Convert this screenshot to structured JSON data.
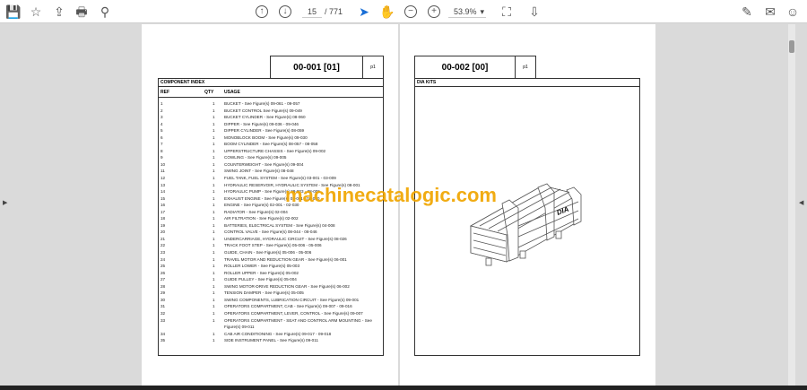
{
  "toolbar": {
    "page_current": "15",
    "page_total": "/ 771",
    "zoom": "53.9%",
    "zoom_caret": "▾"
  },
  "icons": {
    "save": "💾",
    "bookmark": "☆",
    "upload": "⇪",
    "print": "🖶",
    "search": "⚲",
    "prev": "↑",
    "next": "↓",
    "cursor": "➤",
    "hand": "✋",
    "zoom_out": "−",
    "zoom_in": "+",
    "fit": "⛶",
    "scroll": "⇩",
    "sign": "✎",
    "mail": "✉",
    "account": "☺"
  },
  "left_page": {
    "code": "00-001 [01]",
    "p": "p1",
    "title": "COMPONENT INDEX",
    "headers": {
      "ref": "REF",
      "qty": "QTY",
      "usage": "USAGE"
    },
    "rows": [
      [
        "1",
        "1",
        "BUCKET - See Figure(s) 09-061 - 09-057"
      ],
      [
        "2",
        "1",
        "BUCKET CONTROL See Figure(s) 09-049"
      ],
      [
        "3",
        "1",
        "BUCKET CYLINDER - See Figure(s) 08-060"
      ],
      [
        "4",
        "1",
        "DIPPER - See Figure(s) 09-036 - 09-046"
      ],
      [
        "5",
        "1",
        "DIPPER CYLINDER - See Figure(s) 08-059"
      ],
      [
        "6",
        "1",
        "MONOBLOCK BOOM - See Figure(s) 09-030"
      ],
      [
        "7",
        "1",
        "BOOM CYLINDER - See Figure(s) 08-057 - 08-058"
      ],
      [
        "8",
        "1",
        "UPPERSTRUCTURE CHASSIS - See  Figure(s) 09-002"
      ],
      [
        "9",
        "1",
        "COWLING - See Figure(s) 09-005"
      ],
      [
        "10",
        "1",
        "COUNTERWEIGHT - See Figure(s) 09-004"
      ],
      [
        "11",
        "1",
        "SWING JOINT - See Figure(s) 08-048"
      ],
      [
        "12",
        "1",
        "FUEL TANK, FUEL SYSTEM - See Figure(s) 03-001 - 03-009"
      ],
      [
        "13",
        "1",
        "HYDRAULIC RESERVOIR, HYDRAULIC SYSTEM - See Figure(s) 08-001"
      ],
      [
        "14",
        "1",
        "HYDRAULIC PUMP - See Figure(s) 08-003 - 08-005"
      ],
      [
        "15",
        "1",
        "EXHAUST ENGINE - See Figure(s) 02-001 - 02-030"
      ],
      [
        "16",
        "1",
        "ENGINE - See Figure(s) 02-001 - 02-030"
      ],
      [
        "17",
        "1",
        "RADIATOR - See Figure(s) 02-004"
      ],
      [
        "18",
        "1",
        "AIR FILTRATION - See Figure(s) 02-002"
      ],
      [
        "19",
        "1",
        "BATTERIES, ELECTRICAL SYSTEM - See Figure(s) 04-008"
      ],
      [
        "20",
        "1",
        "CONTROL VALVE - See Figure(s) 08-044 - 08-046"
      ],
      [
        "21",
        "1",
        "UNDERCARRIAGE, HYDRAULIC CIRCUIT - See Figure(s) 08-026"
      ],
      [
        "22",
        "1",
        "TRACK FOOT STEP - See Figure(s) 05-006 - 05-006"
      ],
      [
        "23",
        "1",
        "GUIDE, CHAIN - See Figure(s) 05-006 - 05-006"
      ],
      [
        "24",
        "1",
        "TRAVEL MOTOR AND REDUCTION GEAR - See Figure(s) 06-001"
      ],
      [
        "25",
        "1",
        "ROLLER LOWER - See Figure(s) 05-003"
      ],
      [
        "26",
        "1",
        "ROLLER UPPER - See Figure(s) 05-002"
      ],
      [
        "27",
        "1",
        "GUIDE PULLEY - See Figure(s) 05-004"
      ],
      [
        "28",
        "1",
        "SWING MOTOR-DRIVE REDUCTION GEAR - See Figure(s) 06-002"
      ],
      [
        "29",
        "1",
        "TENSION DAMPER - See Figure(s) 05-005"
      ],
      [
        "30",
        "1",
        "SWING COMPONENTS, LUBRICATION CIRCUIT - See Figure(s) 09-001"
      ],
      [
        "31",
        "1",
        "OPERATORS COMPARTMENT, CAB - See Figure(s) 09-007 - 09-016"
      ],
      [
        "32",
        "1",
        "OPERATORS COMPARTMENT, LEVER, CONTROL - See Figure(s) 09-007"
      ],
      [
        "33",
        "1",
        "OPERATORS COMPARTMENT - SEAT AND CONTROL ARM MOUNTING - See Figure(s) 09-011"
      ],
      [
        "34",
        "1",
        "CAB AIR CONDITIONING - See Figure(s) 09-017 - 09-018"
      ],
      [
        "35",
        "1",
        "SIDE INSTRUMENT PANEL - See Figure(s) 09-011"
      ]
    ]
  },
  "right_page": {
    "code": "00-002 [00]",
    "p": "p1",
    "title": "DIA KITS",
    "crate_label": "DIA"
  },
  "watermark": "machinecatalogic.com"
}
